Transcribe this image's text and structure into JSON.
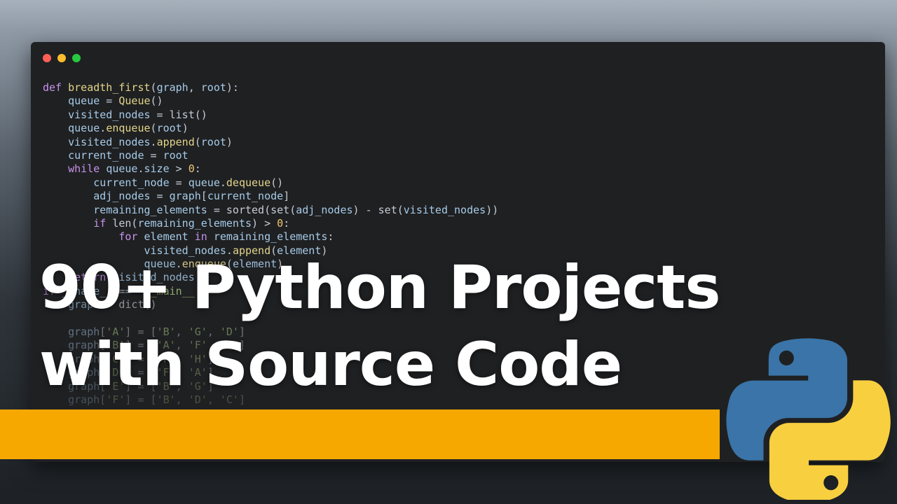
{
  "title": {
    "line1": "90+ Python Projects",
    "line2": "with Source Code"
  },
  "window": {
    "dots": [
      "#ff5f56",
      "#ffbd2e",
      "#27c93f"
    ]
  },
  "colors": {
    "banner": "#f6a800",
    "python_blue": "#3a74a8",
    "python_yellow": "#f8cf3f"
  },
  "logo": {
    "icon": "python-logo-icon"
  },
  "code_lines": [
    [
      [
        "kw",
        "def "
      ],
      [
        "fn",
        "breadth_first"
      ],
      [
        "op",
        "("
      ],
      [
        "var",
        "graph"
      ],
      [
        "op",
        ", "
      ],
      [
        "var",
        "root"
      ],
      [
        "op",
        "):"
      ]
    ],
    [
      [
        "op",
        "    "
      ],
      [
        "var",
        "queue"
      ],
      [
        "op",
        " = "
      ],
      [
        "fn",
        "Queue"
      ],
      [
        "op",
        "()"
      ]
    ],
    [
      [
        "op",
        "    "
      ],
      [
        "var",
        "visited_nodes"
      ],
      [
        "op",
        " = list()"
      ]
    ],
    [
      [
        "op",
        "    "
      ],
      [
        "var",
        "queue"
      ],
      [
        "op",
        "."
      ],
      [
        "fn",
        "enqueue"
      ],
      [
        "op",
        "("
      ],
      [
        "var",
        "root"
      ],
      [
        "op",
        ")"
      ]
    ],
    [
      [
        "op",
        "    "
      ],
      [
        "var",
        "visited_nodes"
      ],
      [
        "op",
        "."
      ],
      [
        "fn",
        "append"
      ],
      [
        "op",
        "("
      ],
      [
        "var",
        "root"
      ],
      [
        "op",
        ")"
      ]
    ],
    [
      [
        "op",
        "    "
      ],
      [
        "var",
        "current_node"
      ],
      [
        "op",
        " = "
      ],
      [
        "var",
        "root"
      ]
    ],
    [
      [
        "op",
        "    "
      ],
      [
        "kw",
        "while "
      ],
      [
        "var",
        "queue"
      ],
      [
        "op",
        "."
      ],
      [
        "var",
        "size"
      ],
      [
        "op",
        " > "
      ],
      [
        "num",
        "0"
      ],
      [
        "op",
        ":"
      ]
    ],
    [
      [
        "op",
        "        "
      ],
      [
        "var",
        "current_node"
      ],
      [
        "op",
        " = "
      ],
      [
        "var",
        "queue"
      ],
      [
        "op",
        "."
      ],
      [
        "fn",
        "dequeue"
      ],
      [
        "op",
        "()"
      ]
    ],
    [
      [
        "op",
        "        "
      ],
      [
        "var",
        "adj_nodes"
      ],
      [
        "op",
        " = "
      ],
      [
        "var",
        "graph"
      ],
      [
        "op",
        "["
      ],
      [
        "var",
        "current_node"
      ],
      [
        "op",
        "]"
      ]
    ],
    [
      [
        "op",
        "        "
      ],
      [
        "var",
        "remaining_elements"
      ],
      [
        "op",
        " = sorted(set("
      ],
      [
        "var",
        "adj_nodes"
      ],
      [
        "op",
        ") - set("
      ],
      [
        "var",
        "visited_nodes"
      ],
      [
        "op",
        "))"
      ]
    ],
    [
      [
        "op",
        "        "
      ],
      [
        "kw",
        "if "
      ],
      [
        "op",
        "len("
      ],
      [
        "var",
        "remaining_elements"
      ],
      [
        "op",
        ") > "
      ],
      [
        "num",
        "0"
      ],
      [
        "op",
        ":"
      ]
    ],
    [
      [
        "op",
        "            "
      ],
      [
        "kw",
        "for "
      ],
      [
        "var",
        "element "
      ],
      [
        "kw",
        "in "
      ],
      [
        "var",
        "remaining_elements"
      ],
      [
        "op",
        ":"
      ]
    ],
    [
      [
        "op",
        "                "
      ],
      [
        "var",
        "visited_nodes"
      ],
      [
        "op",
        "."
      ],
      [
        "fn",
        "append"
      ],
      [
        "op",
        "("
      ],
      [
        "var",
        "element"
      ],
      [
        "op",
        ")"
      ]
    ],
    [
      [
        "op",
        "                "
      ],
      [
        "var",
        "queue"
      ],
      [
        "op",
        "."
      ],
      [
        "fn",
        "enqueue"
      ],
      [
        "op",
        "("
      ],
      [
        "var",
        "element"
      ],
      [
        "op",
        ")"
      ]
    ],
    [
      [
        "op",
        "    "
      ],
      [
        "kw",
        "return "
      ],
      [
        "var",
        "visited_nodes"
      ]
    ],
    [
      [
        "kw",
        "if "
      ],
      [
        "var",
        "__name__"
      ],
      [
        "op",
        " == "
      ],
      [
        "str",
        "'__main__'"
      ],
      [
        "op",
        ":"
      ]
    ],
    [
      [
        "op",
        "    "
      ],
      [
        "var",
        "graph"
      ],
      [
        "op",
        " = dict()"
      ]
    ],
    [
      [
        "op",
        ""
      ]
    ],
    [
      [
        "op",
        "    "
      ],
      [
        "var",
        "graph"
      ],
      [
        "op",
        "["
      ],
      [
        "str",
        "'A'"
      ],
      [
        "op",
        "] = ["
      ],
      [
        "str",
        "'B'"
      ],
      [
        "op",
        ", "
      ],
      [
        "str",
        "'G'"
      ],
      [
        "op",
        ", "
      ],
      [
        "str",
        "'D'"
      ],
      [
        "op",
        "]"
      ]
    ],
    [
      [
        "op",
        "    "
      ],
      [
        "var",
        "graph"
      ],
      [
        "op",
        "["
      ],
      [
        "str",
        "'B'"
      ],
      [
        "op",
        "] = ["
      ],
      [
        "str",
        "'A'"
      ],
      [
        "op",
        ", "
      ],
      [
        "str",
        "'F'"
      ],
      [
        "op",
        ", "
      ],
      [
        "str",
        "'E'"
      ],
      [
        "op",
        "]"
      ]
    ],
    [
      [
        "op",
        "    "
      ],
      [
        "var",
        "graph"
      ],
      [
        "op",
        "["
      ],
      [
        "str",
        "'C'"
      ],
      [
        "op",
        "] = ["
      ],
      [
        "str",
        "'F'"
      ],
      [
        "op",
        ", "
      ],
      [
        "str",
        "'H'"
      ],
      [
        "op",
        "]"
      ]
    ],
    [
      [
        "op",
        "    "
      ],
      [
        "var",
        "graph"
      ],
      [
        "op",
        "["
      ],
      [
        "str",
        "'D'"
      ],
      [
        "op",
        "] = ["
      ],
      [
        "str",
        "'F'"
      ],
      [
        "op",
        ", "
      ],
      [
        "str",
        "'A'"
      ],
      [
        "op",
        "]"
      ]
    ],
    [
      [
        "op",
        "    "
      ],
      [
        "var",
        "graph"
      ],
      [
        "op",
        "["
      ],
      [
        "str",
        "'E'"
      ],
      [
        "op",
        "] = ["
      ],
      [
        "str",
        "'B'"
      ],
      [
        "op",
        ", "
      ],
      [
        "str",
        "'G'"
      ],
      [
        "op",
        "]"
      ]
    ],
    [
      [
        "op",
        "    "
      ],
      [
        "var",
        "graph"
      ],
      [
        "op",
        "["
      ],
      [
        "str",
        "'F'"
      ],
      [
        "op",
        "] = ["
      ],
      [
        "str",
        "'B'"
      ],
      [
        "op",
        ", "
      ],
      [
        "str",
        "'D'"
      ],
      [
        "op",
        ", "
      ],
      [
        "str",
        "'C'"
      ],
      [
        "op",
        "]"
      ]
    ]
  ]
}
